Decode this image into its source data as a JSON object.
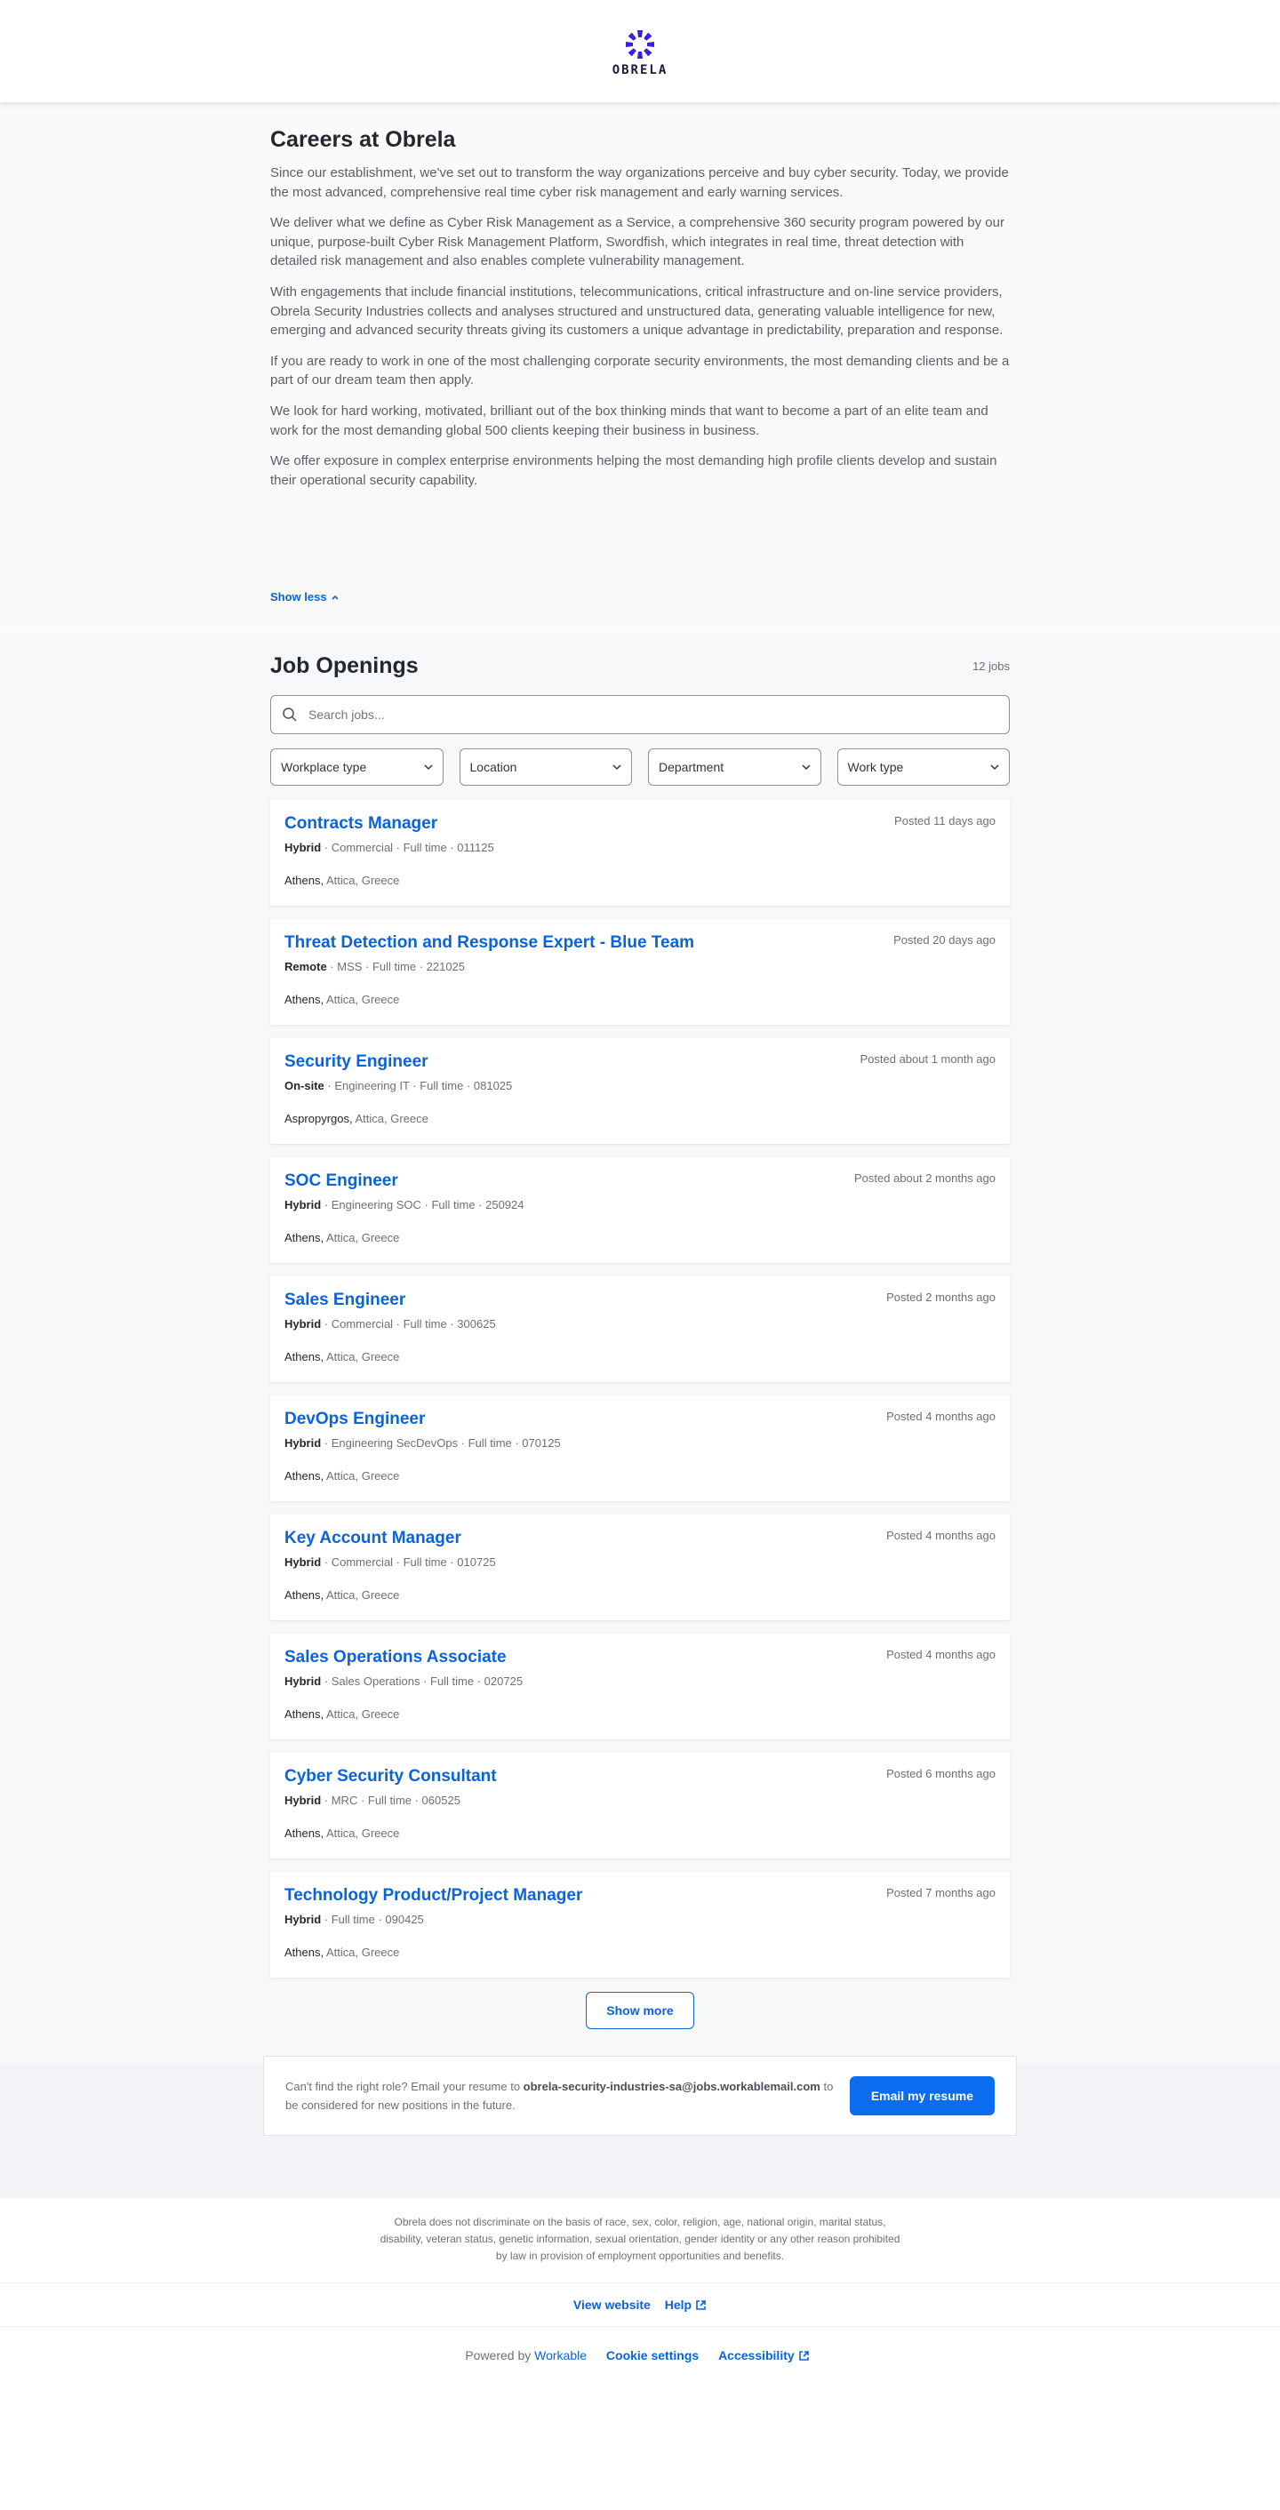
{
  "header": {
    "logo_text": "OBRELA"
  },
  "intro": {
    "title": "Careers at Obrela",
    "paragraphs": [
      "Since our establishment, we've set out to transform the way organizations perceive and buy cyber security. Today, we provide the most advanced, comprehensive real time cyber risk management and early warning services.",
      "We deliver what we define as Cyber Risk Management as a Service, a comprehensive 360 security program powered by our unique, purpose-built Cyber Risk Management Platform, Swordfish, which integrates in real time, threat detection with detailed risk management and also enables complete vulnerability management.",
      "With engagements that include financial institutions, telecommunications, critical infrastructure and on-line service providers, Obrela Security Industries collects and analyses structured and unstructured data, generating valuable intelligence for new, emerging and advanced security threats giving its customers a unique advantage in predictability, preparation and response.",
      "If you are ready to work in one of the most challenging corporate security environments, the most demanding clients and be a part of our dream team then apply.",
      "We look for hard working, motivated, brilliant out of the box thinking minds that want to become a part of an elite team and work for the most demanding global 500 clients keeping their business in business.",
      "We offer exposure in complex enterprise environments helping the most demanding high profile clients develop and sustain their operational security capability."
    ],
    "show_less": "Show less"
  },
  "jobs": {
    "heading": "Job Openings",
    "count": "12 jobs",
    "search_placeholder": "Search jobs...",
    "filters": [
      "Workplace type",
      "Location",
      "Department",
      "Work type"
    ],
    "items": [
      {
        "title": "Contracts Manager",
        "posted": "Posted 11 days ago",
        "workplace": "Hybrid",
        "details": " · Commercial · Full time · 011125",
        "city": "Athens,",
        "region": " Attica, Greece"
      },
      {
        "title": "Threat Detection and Response Expert - Blue Team",
        "posted": "Posted 20 days ago",
        "workplace": "Remote",
        "details": " · MSS · Full time · 221025",
        "city": "Athens,",
        "region": " Attica, Greece"
      },
      {
        "title": "Security Engineer",
        "posted": "Posted about 1 month ago",
        "workplace": "On-site",
        "details": " · Engineering IT · Full time · 081025",
        "city": "Aspropyrgos,",
        "region": " Attica, Greece"
      },
      {
        "title": "SOC Engineer",
        "posted": "Posted about 2 months ago",
        "workplace": "Hybrid",
        "details": " · Engineering SOC · Full time · 250924",
        "city": "Athens,",
        "region": " Attica, Greece"
      },
      {
        "title": "Sales Engineer",
        "posted": "Posted 2 months ago",
        "workplace": "Hybrid",
        "details": " · Commercial · Full time · 300625",
        "city": "Athens,",
        "region": " Attica, Greece"
      },
      {
        "title": "DevOps Engineer",
        "posted": "Posted 4 months ago",
        "workplace": "Hybrid",
        "details": " · Engineering SecDevOps · Full time · 070125",
        "city": "Athens,",
        "region": " Attica, Greece"
      },
      {
        "title": "Key Account Manager",
        "posted": "Posted 4 months ago",
        "workplace": "Hybrid",
        "details": " · Commercial · Full time · 010725",
        "city": "Athens,",
        "region": " Attica, Greece"
      },
      {
        "title": "Sales Operations Associate",
        "posted": "Posted 4 months ago",
        "workplace": "Hybrid",
        "details": " · Sales Operations · Full time · 020725",
        "city": "Athens,",
        "region": " Attica, Greece"
      },
      {
        "title": "Cyber Security Consultant",
        "posted": "Posted 6 months ago",
        "workplace": "Hybrid",
        "details": " · MRC · Full time · 060525",
        "city": "Athens,",
        "region": " Attica, Greece"
      },
      {
        "title": "Technology Product/Project Manager",
        "posted": "Posted 7 months ago",
        "workplace": "Hybrid",
        "details": " · Full time · 090425",
        "city": "Athens,",
        "region": " Attica, Greece"
      }
    ],
    "show_more": "Show more"
  },
  "cta": {
    "text_before": "Can't find the right role? Email your resume to ",
    "email": "obrela-security-industries-sa@jobs.workablemail.com",
    "text_after": " to be considered for new positions in the future.",
    "button": "Email my resume"
  },
  "footer": {
    "eeo": "Obrela does not discriminate on the basis of race, sex, color, religion, age, national origin, marital status, disability, veteran status, genetic information, sexual orientation, gender identity or any other reason prohibited by law in provision of employment opportunities and benefits.",
    "view_website": "View website",
    "help": "Help",
    "powered_by": "Powered by ",
    "workable": "Workable",
    "cookie_settings": "Cookie settings",
    "accessibility": "Accessibility"
  },
  "colors": {
    "accent": "#0b63d6",
    "button": "#0b6cf0",
    "logo": "#3a1ee0"
  }
}
